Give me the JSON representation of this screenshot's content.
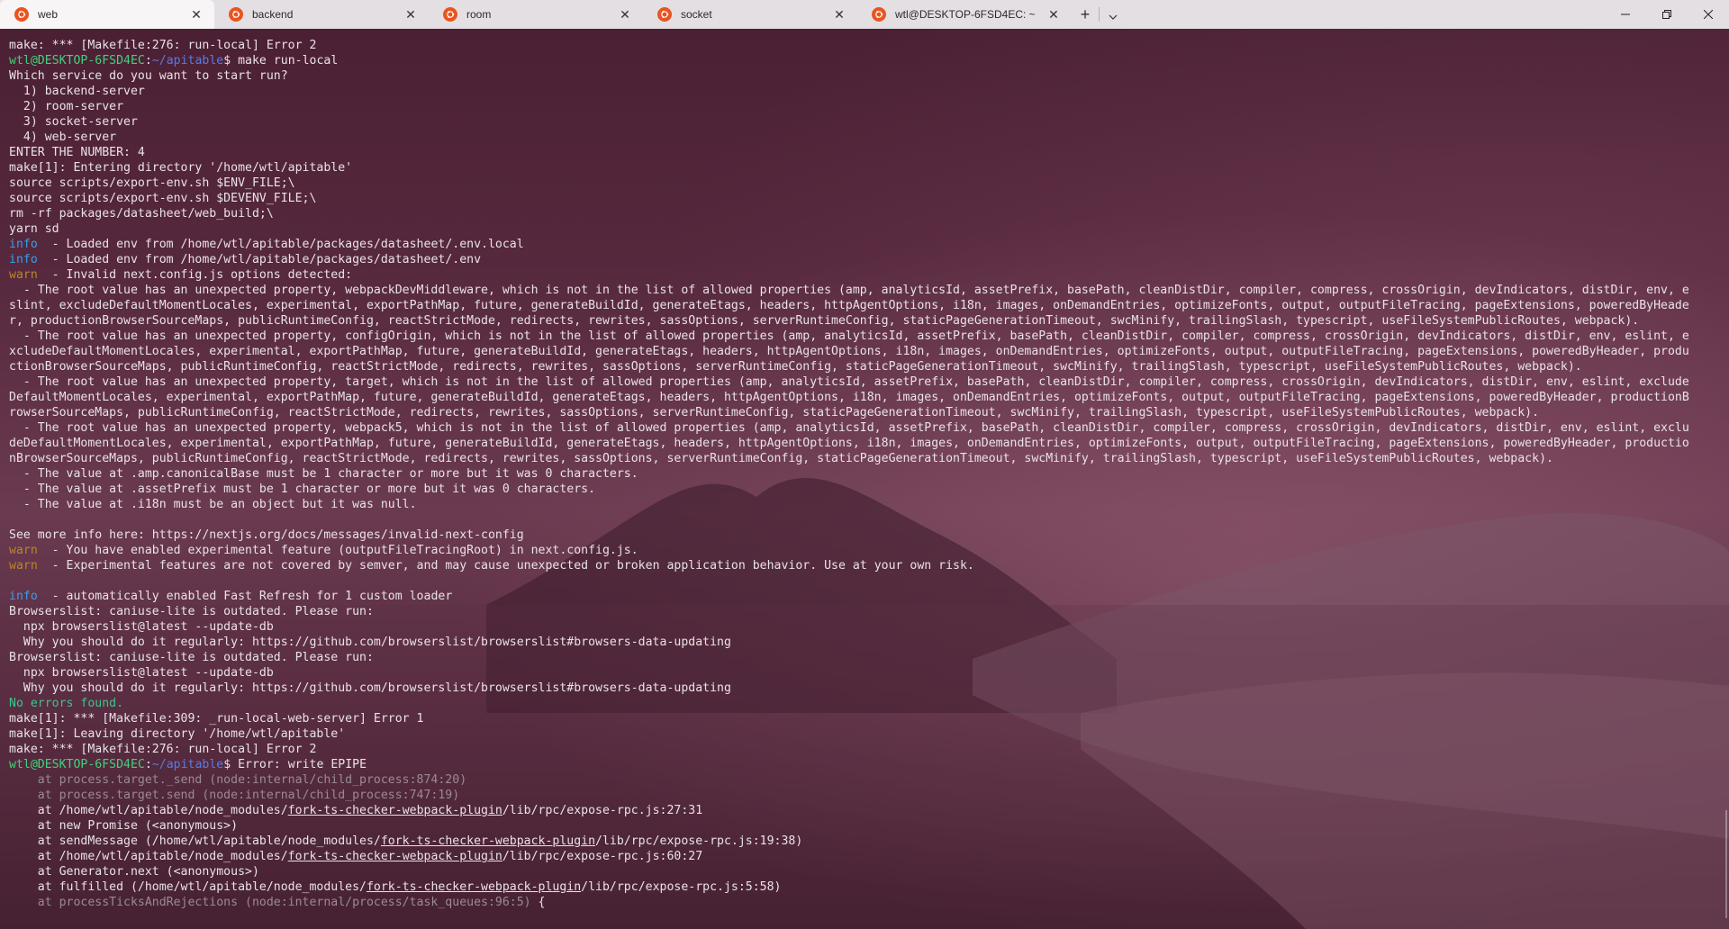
{
  "tabs": [
    {
      "label": "web",
      "active": true
    },
    {
      "label": "backend",
      "active": false
    },
    {
      "label": "room",
      "active": false
    },
    {
      "label": "socket",
      "active": false
    },
    {
      "label": "wtl@DESKTOP-6FSD4EC: ~",
      "active": false
    }
  ],
  "tab_actions": {
    "new_tab": "+",
    "dropdown": "⌄"
  },
  "window_controls": {
    "minimize": "—",
    "restore": "❐",
    "close": "✕"
  },
  "prompt": {
    "user_host": "wtl@DESKTOP-6FSD4EC",
    "colon": ":",
    "path": "~/apitable",
    "dollar": "$"
  },
  "terminal": {
    "l01": "make: *** [Makefile:276: run-local] Error 2",
    "l02_cmd": " make run-local",
    "l03": "Which service do you want to start run?",
    "l04": "  1) backend-server",
    "l05": "  2) room-server",
    "l06": "  3) socket-server",
    "l07": "  4) web-server",
    "l08": "ENTER THE NUMBER: 4",
    "l09": "make[1]: Entering directory '/home/wtl/apitable'",
    "l10": "source scripts/export-env.sh $ENV_FILE;\\",
    "l11": "source scripts/export-env.sh $DEVENV_FILE;\\",
    "l12": "rm -rf packages/datasheet/web_build;\\",
    "l13": "yarn sd",
    "l14_tag": "info",
    "l14": "  - Loaded env from /home/wtl/apitable/packages/datasheet/.env.local",
    "l15_tag": "info",
    "l15": "  - Loaded env from /home/wtl/apitable/packages/datasheet/.env",
    "l16_tag": "warn",
    "l16": "  - Invalid next.config.js options detected:",
    "l17": "  - The root value has an unexpected property, webpackDevMiddleware, which is not in the list of allowed properties (amp, analyticsId, assetPrefix, basePath, cleanDistDir, compiler, compress, crossOrigin, devIndicators, distDir, env, e",
    "l18": "slint, excludeDefaultMomentLocales, experimental, exportPathMap, future, generateBuildId, generateEtags, headers, httpAgentOptions, i18n, images, onDemandEntries, optimizeFonts, output, outputFileTracing, pageExtensions, poweredByHeade",
    "l19": "r, productionBrowserSourceMaps, publicRuntimeConfig, reactStrictMode, redirects, rewrites, sassOptions, serverRuntimeConfig, staticPageGenerationTimeout, swcMinify, trailingSlash, typescript, useFileSystemPublicRoutes, webpack).",
    "l20": "  - The root value has an unexpected property, configOrigin, which is not in the list of allowed properties (amp, analyticsId, assetPrefix, basePath, cleanDistDir, compiler, compress, crossOrigin, devIndicators, distDir, env, eslint, e",
    "l21": "xcludeDefaultMomentLocales, experimental, exportPathMap, future, generateBuildId, generateEtags, headers, httpAgentOptions, i18n, images, onDemandEntries, optimizeFonts, output, outputFileTracing, pageExtensions, poweredByHeader, produ",
    "l22": "ctionBrowserSourceMaps, publicRuntimeConfig, reactStrictMode, redirects, rewrites, sassOptions, serverRuntimeConfig, staticPageGenerationTimeout, swcMinify, trailingSlash, typescript, useFileSystemPublicRoutes, webpack).",
    "l23": "  - The root value has an unexpected property, target, which is not in the list of allowed properties (amp, analyticsId, assetPrefix, basePath, cleanDistDir, compiler, compress, crossOrigin, devIndicators, distDir, env, eslint, exclude",
    "l24": "DefaultMomentLocales, experimental, exportPathMap, future, generateBuildId, generateEtags, headers, httpAgentOptions, i18n, images, onDemandEntries, optimizeFonts, output, outputFileTracing, pageExtensions, poweredByHeader, productionB",
    "l25": "rowserSourceMaps, publicRuntimeConfig, reactStrictMode, redirects, rewrites, sassOptions, serverRuntimeConfig, staticPageGenerationTimeout, swcMinify, trailingSlash, typescript, useFileSystemPublicRoutes, webpack).",
    "l26": "  - The root value has an unexpected property, webpack5, which is not in the list of allowed properties (amp, analyticsId, assetPrefix, basePath, cleanDistDir, compiler, compress, crossOrigin, devIndicators, distDir, env, eslint, exclu",
    "l27": "deDefaultMomentLocales, experimental, exportPathMap, future, generateBuildId, generateEtags, headers, httpAgentOptions, i18n, images, onDemandEntries, optimizeFonts, output, outputFileTracing, pageExtensions, poweredByHeader, productio",
    "l28": "nBrowserSourceMaps, publicRuntimeConfig, reactStrictMode, redirects, rewrites, sassOptions, serverRuntimeConfig, staticPageGenerationTimeout, swcMinify, trailingSlash, typescript, useFileSystemPublicRoutes, webpack).",
    "l29": "  - The value at .amp.canonicalBase must be 1 character or more but it was 0 characters.",
    "l30": "  - The value at .assetPrefix must be 1 character or more but it was 0 characters.",
    "l31": "  - The value at .i18n must be an object but it was null.",
    "l32": "",
    "l33": "See more info here: https://nextjs.org/docs/messages/invalid-next-config",
    "l34_tag": "warn",
    "l34": "  - You have enabled experimental feature (outputFileTracingRoot) in next.config.js.",
    "l35_tag": "warn",
    "l35": "  - Experimental features are not covered by semver, and may cause unexpected or broken application behavior. Use at your own risk.",
    "l36": "",
    "l37_tag": "info",
    "l37": "  - automatically enabled Fast Refresh for 1 custom loader",
    "l38": "Browserslist: caniuse-lite is outdated. Please run:",
    "l39": "  npx browserslist@latest --update-db",
    "l40": "  Why you should do it regularly: https://github.com/browserslist/browserslist#browsers-data-updating",
    "l41": "Browserslist: caniuse-lite is outdated. Please run:",
    "l42": "  npx browserslist@latest --update-db",
    "l43": "  Why you should do it regularly: https://github.com/browserslist/browserslist#browsers-data-updating",
    "l44": "No errors found.",
    "l45": "make[1]: *** [Makefile:309: _run-local-web-server] Error 1",
    "l46": "make[1]: Leaving directory '/home/wtl/apitable'",
    "l47": "make: *** [Makefile:276: run-local] Error 2",
    "l48_cmd": " Error: write EPIPE",
    "l49": "    at process.target._send (node:internal/child_process:874:20)",
    "l50": "    at process.target.send (node:internal/child_process:747:19)",
    "l51_a": "    at /home/wtl/apitable/node_modules/",
    "l51_b": "fork-ts-checker-webpack-plugin",
    "l51_c": "/lib/rpc/expose-rpc.js:27:31",
    "l52": "    at new Promise (<anonymous>)",
    "l53_a": "    at sendMessage (/home/wtl/apitable/node_modules/",
    "l53_b": "fork-ts-checker-webpack-plugin",
    "l53_c": "/lib/rpc/expose-rpc.js:19:38)",
    "l54_a": "    at /home/wtl/apitable/node_modules/",
    "l54_b": "fork-ts-checker-webpack-plugin",
    "l54_c": "/lib/rpc/expose-rpc.js:60:27",
    "l55": "    at Generator.next (<anonymous>)",
    "l56_a": "    at fulfilled (/home/wtl/apitable/node_modules/",
    "l56_b": "fork-ts-checker-webpack-plugin",
    "l56_c": "/lib/rpc/expose-rpc.js:5:58)",
    "l57": "    at processTicksAndRejections (node:internal/process/task_queues:96:5)",
    "l57_brace": " {"
  },
  "colors": {
    "prompt": "#42d17a",
    "path": "#5b7be0",
    "info": "#3b9ee8",
    "warn": "#b8872a",
    "success": "#3ec58a",
    "tab_icon": "#e95420"
  },
  "icons": {
    "tab_icon": "ubuntu-icon",
    "close": "close-icon"
  }
}
